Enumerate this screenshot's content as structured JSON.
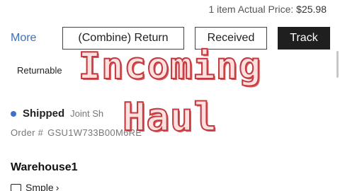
{
  "header": {
    "item_count": "1 item",
    "actual_price_label": "Actual Price:",
    "actual_price_value": "$25.98"
  },
  "actions": {
    "more_label": "More",
    "combine_return_label": "(Combine) Return",
    "received_label": "Received",
    "track_label": "Track"
  },
  "policy": {
    "returnable_label": "Returnable"
  },
  "shipment": {
    "status": "Shipped",
    "sub_status": "Joint Sh",
    "order_label": "Order #",
    "order_number": "GSU1W733B00M6RE",
    "status_color": "#3f6fcb"
  },
  "warehouse": {
    "title": "Warehouse1",
    "sample_label": "Smple",
    "sample_chevron": "›"
  },
  "overlay": {
    "line1": "Incoming",
    "line2": "Haul",
    "fill_color": "#ffe0e0",
    "outline_color": "#c43b3f"
  },
  "icons": {
    "status": "status-dot-icon",
    "sample": "package-icon",
    "chevron": "chevron-right-icon"
  }
}
